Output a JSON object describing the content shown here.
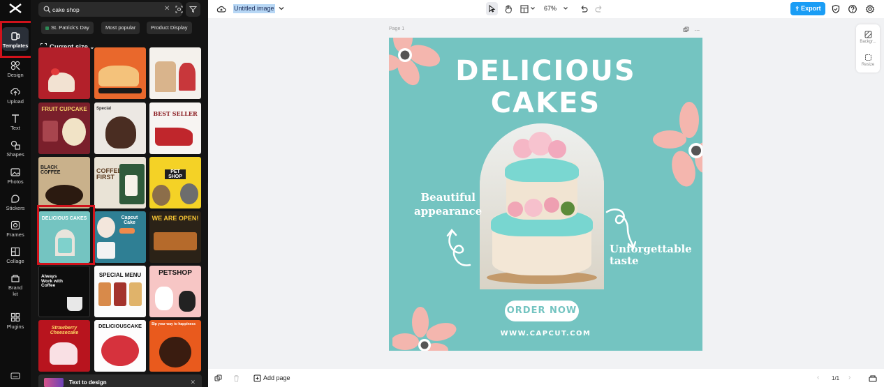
{
  "rail": {
    "items": [
      {
        "label": "Templates",
        "icon": "templates-icon"
      },
      {
        "label": "Design",
        "icon": "design-icon"
      },
      {
        "label": "Upload",
        "icon": "upload-icon"
      },
      {
        "label": "Text",
        "icon": "text-icon"
      },
      {
        "label": "Shapes",
        "icon": "shapes-icon"
      },
      {
        "label": "Photos",
        "icon": "photos-icon"
      },
      {
        "label": "Stickers",
        "icon": "stickers-icon"
      },
      {
        "label": "Frames",
        "icon": "frames-icon"
      },
      {
        "label": "Collage",
        "icon": "collage-icon"
      },
      {
        "label": "Brand kit",
        "icon": "brand-kit-icon"
      },
      {
        "label": "Plugins",
        "icon": "plugins-icon"
      }
    ]
  },
  "panel": {
    "search_value": "cake shop",
    "chips": [
      "St. Patrick's Day",
      "Most popular",
      "Product Display"
    ],
    "size_label": "Current size",
    "templates": [
      {
        "text": "",
        "bg": "#b3202a"
      },
      {
        "text": "",
        "bg": "#e9682c"
      },
      {
        "text": "",
        "bg": "#f4f1ec"
      },
      {
        "text": "FRUIT CUPCAKE",
        "bg": "#7a1f2b"
      },
      {
        "text": "Special",
        "bg": "#ece8e3"
      },
      {
        "text": "BEST SELLER",
        "bg": "#f7f4f2"
      },
      {
        "text": "BLACK COFFEE",
        "bg": "#c9b18b"
      },
      {
        "text": "COFFEE FIRST",
        "bg": "#e9e3d6"
      },
      {
        "text": "PET SHOP",
        "bg": "#f4d226"
      },
      {
        "text": "DELICIOUS CAKES",
        "bg": "#74c4c1"
      },
      {
        "text": "Capcut Cake",
        "bg": "#2f7f94"
      },
      {
        "text": "WE ARE OPEN!",
        "bg": "#2b2217"
      },
      {
        "text": "Always Work with Coffee",
        "bg": "#0d0d0d"
      },
      {
        "text": "SPECIAL MENU",
        "bg": "#fbfbfb"
      },
      {
        "text": "PETSHOP",
        "bg": "#f7c6c5"
      },
      {
        "text": "Strawberry Cheesecake",
        "bg": "#b8141e"
      },
      {
        "text": "DELICIOUSCAKE",
        "bg": "#fdfdfd"
      },
      {
        "text": "Sip your way to happiness",
        "bg": "#e95a1d"
      }
    ],
    "text_to_design": "Text to design"
  },
  "topbar": {
    "title": "Untitled image",
    "zoom": "67%",
    "export_label": "Export"
  },
  "workspace": {
    "page_label": "Page 1",
    "right_tools": [
      "Backgr...",
      "Resize"
    ]
  },
  "poster": {
    "title_line1": "DELICIOUS",
    "title_line2": "CAKES",
    "left_text_line1": "Beautiful",
    "left_text_line2": "appearance",
    "right_text_line1": "Unforgettable",
    "right_text_line2": "taste",
    "button": "ORDER NOW",
    "website": "WWW.CAPCUT.COM",
    "colors": {
      "background": "#74c4c1",
      "flower": "#f4b6ae",
      "accent": "#ffffff"
    }
  },
  "bottombar": {
    "add_page": "Add page",
    "pager": "1/1"
  }
}
